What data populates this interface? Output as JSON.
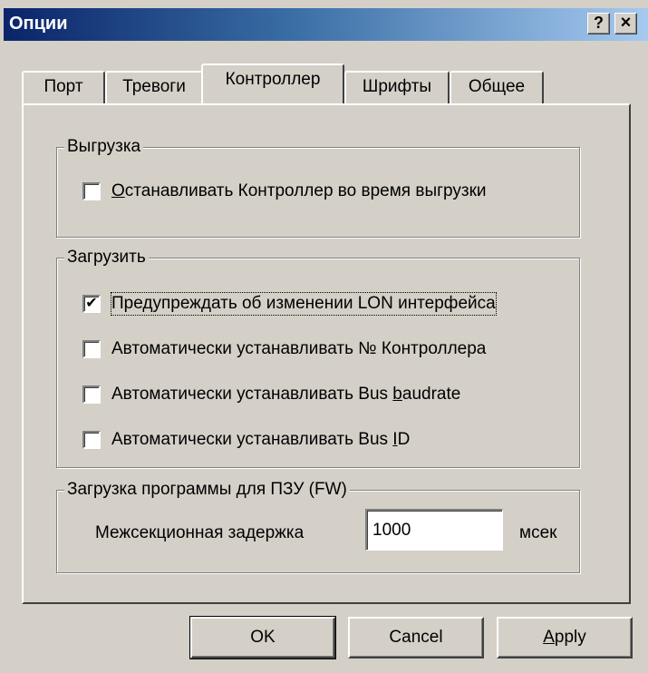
{
  "window": {
    "title": "Опции",
    "help_button": "?",
    "close_button": "×"
  },
  "tabs": [
    {
      "label": "Порт",
      "active": false
    },
    {
      "label": "Тревоги",
      "active": false
    },
    {
      "label": "Контроллер",
      "active": true
    },
    {
      "label": "Шрифты",
      "active": false
    },
    {
      "label": "Общее",
      "active": false
    }
  ],
  "unload_group": {
    "title": "Выгрузка",
    "checkbox": {
      "label_u": "О",
      "label_rest": "станавливать Контроллер во время выгрузки",
      "checked": false
    }
  },
  "load_group": {
    "title": "Загрузить",
    "checkboxes": [
      {
        "label": "Предупреждать об изменении LON интерфейса",
        "checked": true,
        "focused": true
      },
      {
        "label": "Автоматически устанавливать № Контроллера",
        "checked": false
      },
      {
        "label_pre": "Автоматически устанавливать Bus ",
        "label_u": "b",
        "label_post": "audrate",
        "checked": false
      },
      {
        "label_pre": "Автоматически устанавливать Bus ",
        "label_u": "I",
        "label_post": "D",
        "checked": false
      }
    ]
  },
  "fw_group": {
    "title": "Загрузка программы для ПЗУ (FW)",
    "delay_label": "Межсекционная задержка",
    "delay_value": "1000",
    "unit": "мсек"
  },
  "buttons": {
    "ok": "OK",
    "cancel": "Cancel",
    "apply_u": "A",
    "apply_rest": "pply"
  },
  "check_mark": "✔"
}
